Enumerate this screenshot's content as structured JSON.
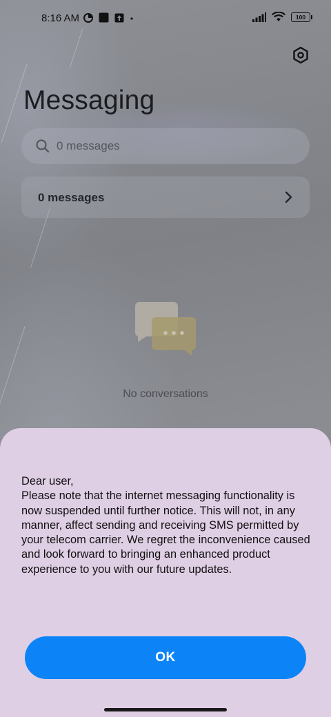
{
  "status_bar": {
    "time": "8:16 AM",
    "battery": "100",
    "icons_left": [
      "data-saver-icon",
      "square-notification-icon",
      "upload-notification-icon",
      "dot-icon"
    ],
    "icons_right": [
      "signal-icon",
      "wifi-icon",
      "battery-icon"
    ]
  },
  "header": {
    "title": "Messaging",
    "settings_icon": "settings-icon"
  },
  "search": {
    "placeholder": "0 messages"
  },
  "messages_card": {
    "label": "0 messages"
  },
  "empty_state": {
    "label": "No conversations"
  },
  "dialog": {
    "message": "Dear user,\nPlease note that the internet messaging functionality is now suspended until further notice. This will not, in any manner, affect sending and receiving SMS permitted by your telecom carrier. We regret the inconvenience caused and look forward to bringing an enhanced product experience to you with our future updates.",
    "ok_label": "OK"
  },
  "colors": {
    "dialog_background": "#dfcfe4",
    "ok_button": "#0c84f8"
  }
}
